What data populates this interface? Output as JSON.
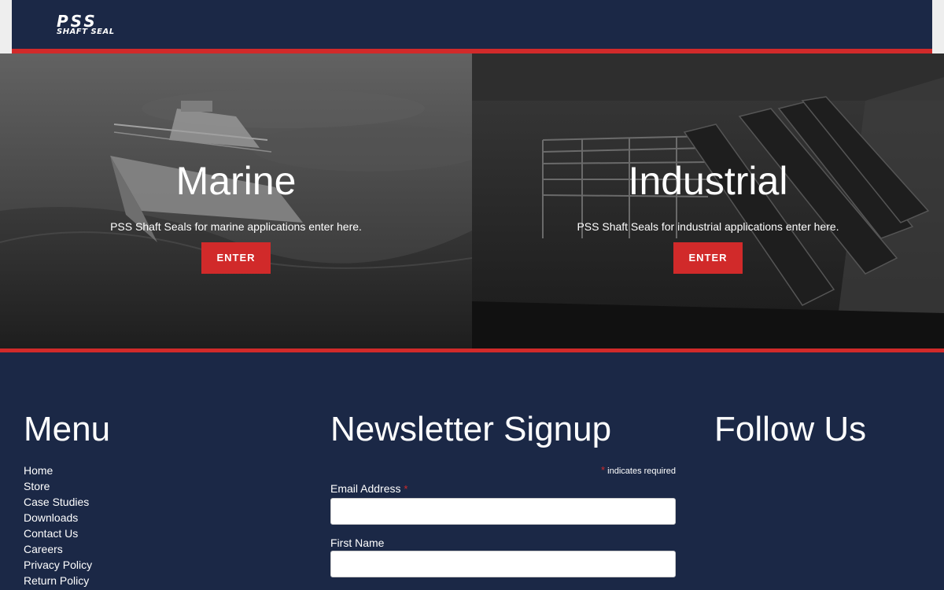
{
  "header": {
    "logo_top": "PSS",
    "logo_bottom": "SHAFT SEAL"
  },
  "hero": {
    "marine": {
      "title": "Marine",
      "subtitle": "PSS Shaft Seals for marine applications enter here.",
      "button_label": "ENTER"
    },
    "industrial": {
      "title": "Industrial",
      "subtitle": "PSS Shaft Seals for industrial applications enter here.",
      "button_label": "ENTER"
    }
  },
  "footer": {
    "menu": {
      "title": "Menu",
      "items": [
        {
          "label": "Home"
        },
        {
          "label": "Store"
        },
        {
          "label": "Case Studies"
        },
        {
          "label": "Downloads"
        },
        {
          "label": "Contact Us"
        },
        {
          "label": "Careers"
        },
        {
          "label": "Privacy Policy"
        },
        {
          "label": "Return Policy"
        }
      ]
    },
    "newsletter": {
      "title": "Newsletter Signup",
      "required_star": "*",
      "required_note": "indicates required",
      "email_label": "Email Address",
      "email_value": "",
      "first_name_label": "First Name",
      "first_name_value": ""
    },
    "follow": {
      "title": "Follow Us"
    }
  },
  "colors": {
    "navy": "#1b2846",
    "accent_red": "#d12a2a",
    "page_bg": "#eeeeee"
  }
}
